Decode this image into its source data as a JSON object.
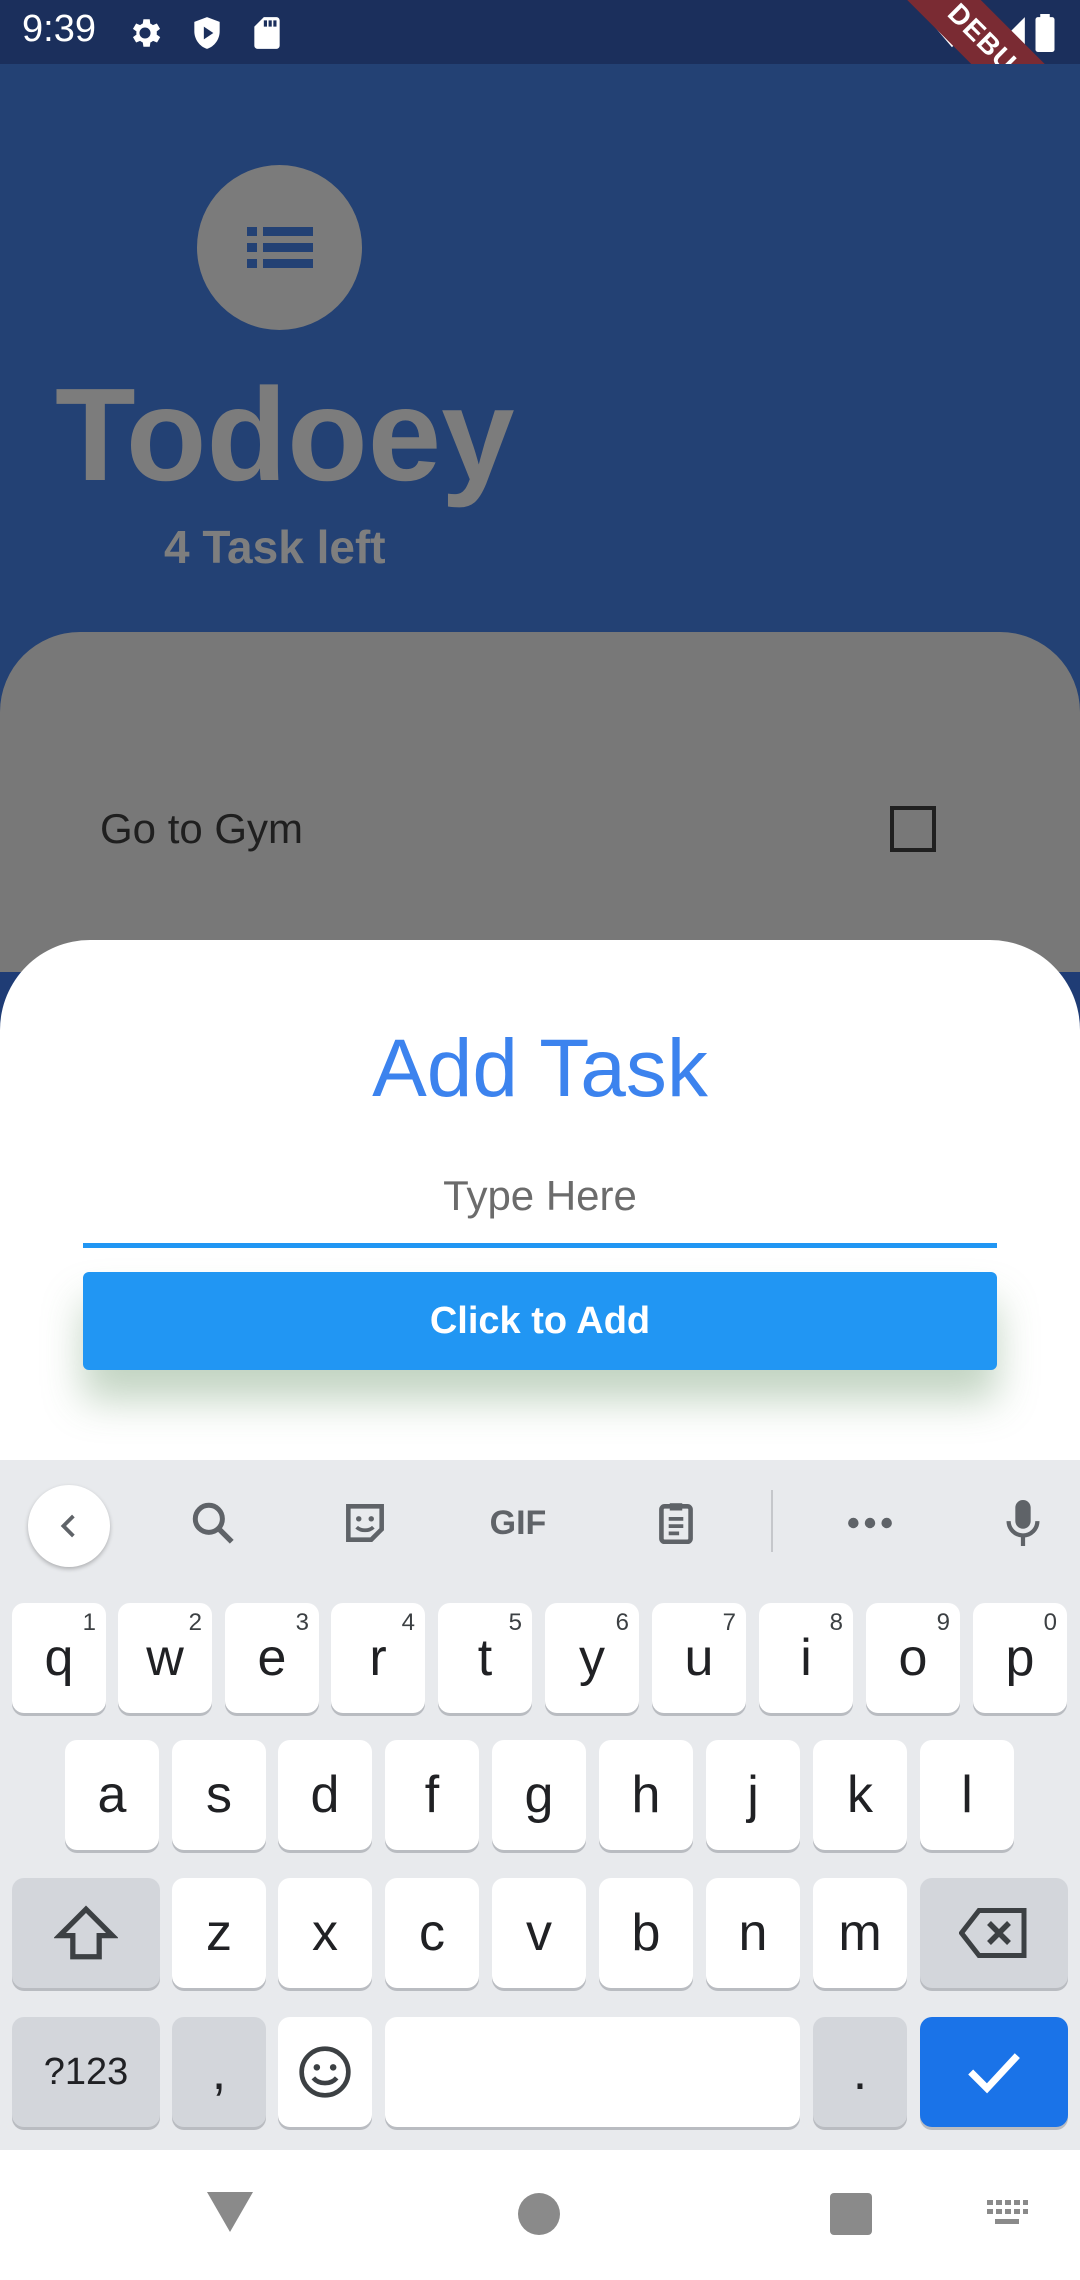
{
  "status_bar": {
    "time": "9:39",
    "debug_label": "DEBUG"
  },
  "app": {
    "title": "Todoey",
    "subtitle": "4 Task left"
  },
  "tasks": [
    {
      "label": "Go to Gym",
      "checked": false
    }
  ],
  "sheet": {
    "title": "Add Task",
    "input_placeholder": "Type Here",
    "input_value": "",
    "button_label": "Click to Add"
  },
  "keyboard": {
    "toolbar": {
      "gif_label": "GIF"
    },
    "row1": [
      {
        "k": "q",
        "h": "1"
      },
      {
        "k": "w",
        "h": "2"
      },
      {
        "k": "e",
        "h": "3"
      },
      {
        "k": "r",
        "h": "4"
      },
      {
        "k": "t",
        "h": "5"
      },
      {
        "k": "y",
        "h": "6"
      },
      {
        "k": "u",
        "h": "7"
      },
      {
        "k": "i",
        "h": "8"
      },
      {
        "k": "o",
        "h": "9"
      },
      {
        "k": "p",
        "h": "0"
      }
    ],
    "row2": [
      "a",
      "s",
      "d",
      "f",
      "g",
      "h",
      "j",
      "k",
      "l"
    ],
    "row3": [
      "z",
      "x",
      "c",
      "v",
      "b",
      "n",
      "m"
    ],
    "symbols_label": "?123",
    "comma": ",",
    "period": "."
  },
  "colors": {
    "accent": "#2196f3",
    "title_blue": "#3c83ee",
    "header_bg": "#234174",
    "enter_key": "#1a73e8"
  }
}
